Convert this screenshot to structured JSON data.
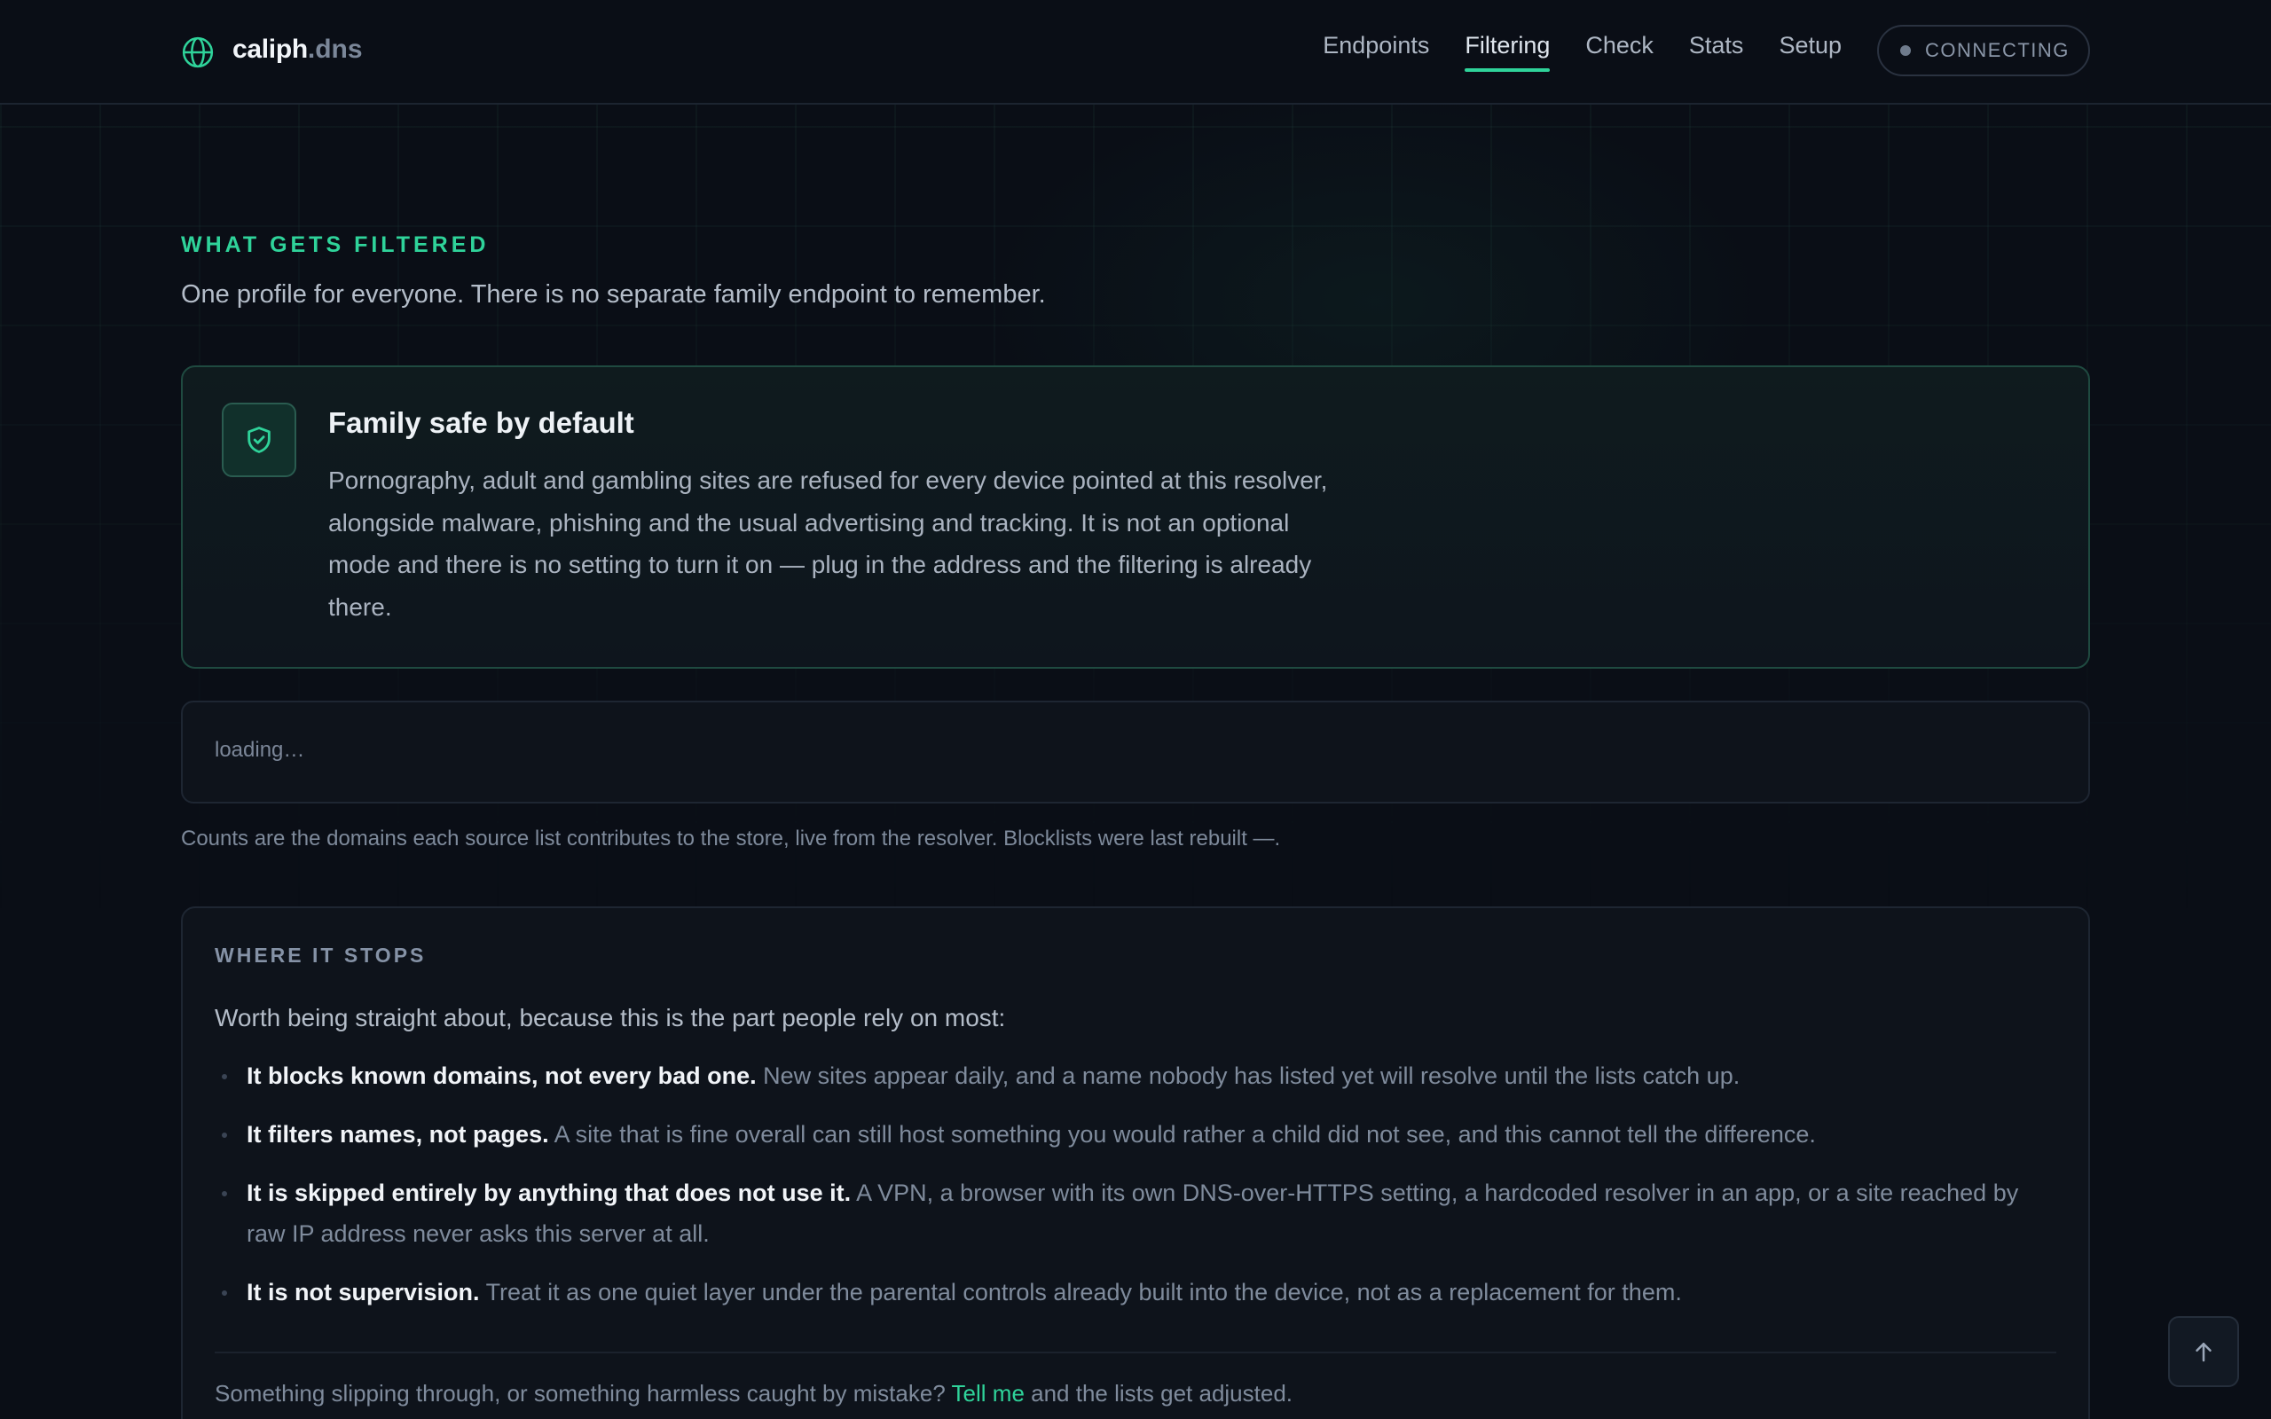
{
  "header": {
    "brand_name": "caliph",
    "brand_tld": ".dns",
    "nav": [
      "Endpoints",
      "Filtering",
      "Check",
      "Stats",
      "Setup"
    ],
    "active_nav": "Filtering",
    "status_label": "CONNECTING"
  },
  "filtering": {
    "kicker": "WHAT GETS FILTERED",
    "subtitle": "One profile for everyone. There is no separate family endpoint to remember.",
    "family_card": {
      "icon": "shield-check-icon",
      "title": "Family safe by default",
      "body": "Pornography, adult and gambling sites are refused for every device pointed at this resolver, alongside malware, phishing and the usual advertising and tracking. It is not an optional mode and there is no setting to turn it on — plug in the address and the filtering is already there."
    },
    "loading_text": "loading…",
    "counts_note": "Counts are the domains each source list contributes to the store, live from the resolver. Blocklists were last rebuilt —."
  },
  "stops": {
    "kicker": "WHERE IT STOPS",
    "intro": "Worth being straight about, because this is the part people rely on most:",
    "items": [
      {
        "lead": "It blocks known domains, not every bad one.",
        "text": "New sites appear daily, and a name nobody has listed yet will resolve until the lists catch up."
      },
      {
        "lead": "It filters names, not pages.",
        "text": "A site that is fine overall can still host something you would rather a child did not see, and this cannot tell the difference."
      },
      {
        "lead": "It is skipped entirely by anything that does not use it.",
        "text": "A VPN, a browser with its own DNS-over-HTTPS setting, a hardcoded resolver in an app, or a site reached by raw IP address never asks this server at all."
      },
      {
        "lead": "It is not supervision.",
        "text": "Treat it as one quiet layer under the parental controls already built into the device, not as a replacement for them."
      }
    ],
    "footer_before": "Something slipping through, or something harmless caught by mistake?",
    "footer_link": "Tell me",
    "footer_after": "and the lists get adjusted."
  },
  "colors": {
    "accent": "#2fd39a",
    "background": "#0a0e16",
    "card": "#0e131b"
  }
}
